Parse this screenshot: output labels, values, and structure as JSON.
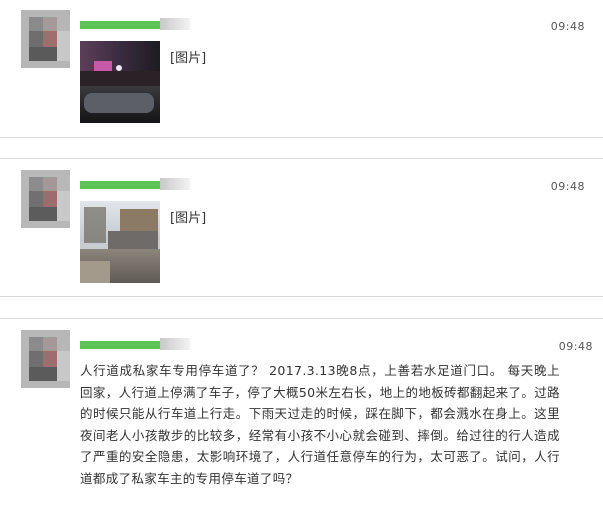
{
  "messages": [
    {
      "time": "09:48",
      "image_label": "[图片]",
      "thumbnail": "night-street-photo"
    },
    {
      "time": "09:48",
      "image_label": "[图片]",
      "thumbnail": "sidewalk-parked-cars-photo"
    },
    {
      "time": "09:48",
      "text": "人行道成私家车专用停车道了？ 2017.3.13晚8点，上善若水足道门口。 每天晚上回家，人行道上停满了车子，停了大概50米左右长，地上的地板砖都翻起来了。过路的时候只能从行车道上行走。下雨天过走的时候，踩在脚下，都会溅水在身上。这里夜间老人小孩散步的比较多，经常有小孩不小心就会碰到、摔倒。给过往的行人造成了严重的安全隐患，太影响环境了，人行道任意停车的行为，太可恶了。试问，人行道都成了私家车主的专用停车道了吗？"
    }
  ],
  "colors": {
    "name_bar": "#5cc356",
    "divider": "#d8d8d8"
  }
}
